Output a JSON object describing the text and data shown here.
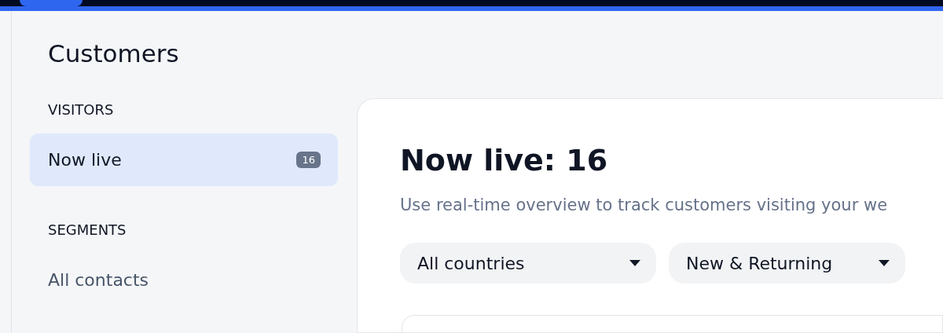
{
  "page_title": "Customers",
  "sidebar": {
    "sections": [
      {
        "heading": "VISITORS",
        "items": [
          {
            "label": "Now live",
            "badge": "16",
            "selected": true
          }
        ]
      },
      {
        "heading": "SEGMENTS",
        "items": [
          {
            "label": "All contacts",
            "selected": false
          }
        ]
      }
    ]
  },
  "main": {
    "title": "Now live: 16",
    "subtitle": "Use real-time overview to track customers visiting your we",
    "filters": [
      {
        "value": "All countries"
      },
      {
        "value": "New & Returning"
      }
    ]
  }
}
